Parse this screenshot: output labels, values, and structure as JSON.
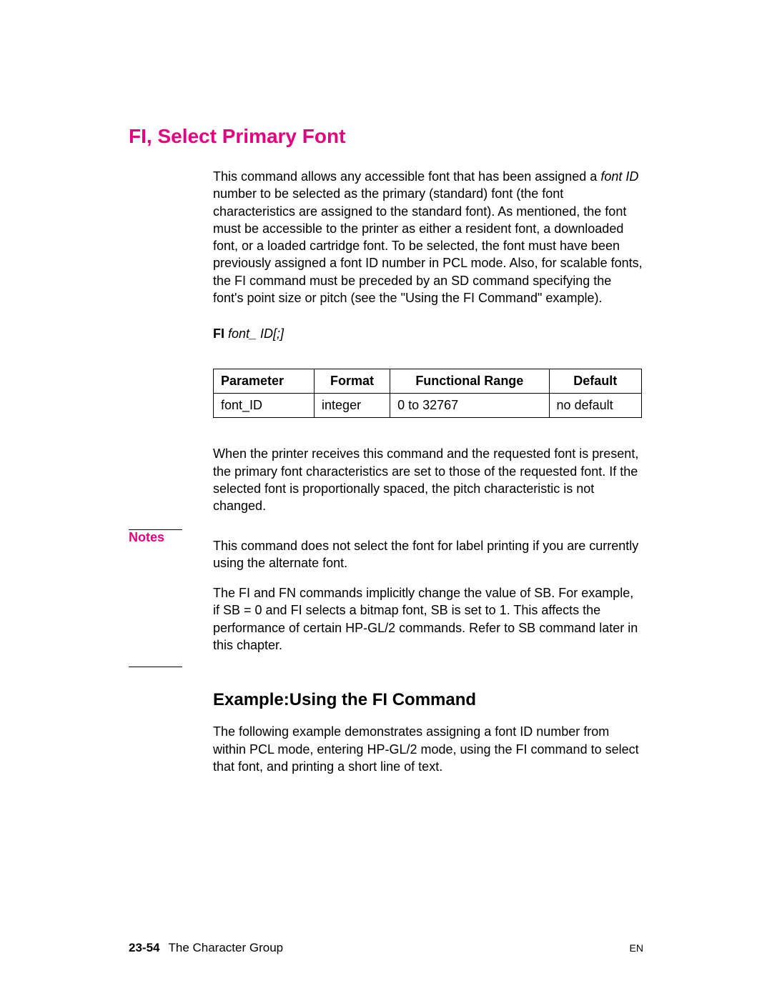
{
  "section": {
    "title": "FI, Select Primary Font",
    "intro_html": "This command allows any accessible font that has been assigned a <span class=\"italic\">font ID</span> number to be selected as the primary (standard) font (the font characteristics are assigned to the standard font). As mentioned, the font must be accessible to the printer as either a resident font, a downloaded font, or a loaded cartridge font. To be selected, the font must have been previously assigned a font ID number in PCL mode. Also, for scalable fonts, the FI command must be preceded by an SD command specifying the font's point size or pitch (see the \"Using the FI Command\" example)."
  },
  "syntax": {
    "cmd": "FI",
    "param": "font_ ID[;]"
  },
  "table": {
    "headers": [
      "Parameter",
      "Format",
      "Functional Range",
      "Default"
    ],
    "row": [
      "font_ID",
      "integer",
      "0 to 32767",
      "no default"
    ]
  },
  "after_table": "When the printer receives this command and the requested font is present, the primary font characteristics are set to those of the requested font. If the selected font is proportionally spaced, the pitch characteristic is not changed.",
  "notes": {
    "label": "Notes",
    "p1": "This command does not select the font for label printing if you are currently using the alternate font.",
    "p2": "The FI and FN commands implicitly change the value of SB. For example, if SB = 0 and FI selects a bitmap font, SB is set to 1. This affects the performance of certain HP-GL/2 commands. Refer to SB command later in this chapter."
  },
  "subsection": {
    "title": "Example:Using the FI Command",
    "body": "The following example demonstrates assigning a font ID number from within PCL mode, entering HP-GL/2 mode, using the FI command to select that font, and printing a short line of text."
  },
  "footer": {
    "page": "23-54",
    "chapter": "The Character Group",
    "lang": "EN"
  }
}
